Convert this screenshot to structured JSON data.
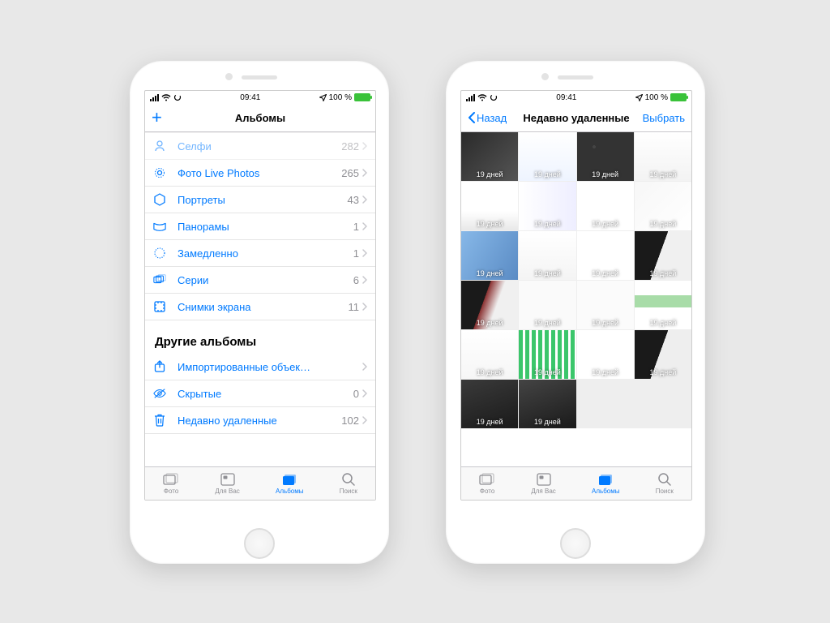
{
  "status": {
    "time": "09:41",
    "battery": "100 %"
  },
  "left": {
    "nav": {
      "title": "Альбомы"
    },
    "rows": [
      {
        "icon": "selfie",
        "label": "Селфи",
        "count": "282"
      },
      {
        "icon": "live",
        "label": "Фото Live Photos",
        "count": "265"
      },
      {
        "icon": "portrait",
        "label": "Портреты",
        "count": "43"
      },
      {
        "icon": "pano",
        "label": "Панорамы",
        "count": "1"
      },
      {
        "icon": "slomo",
        "label": "Замедленно",
        "count": "1"
      },
      {
        "icon": "burst",
        "label": "Серии",
        "count": "6"
      },
      {
        "icon": "screenshot",
        "label": "Снимки экрана",
        "count": "11"
      }
    ],
    "section2_title": "Другие альбомы",
    "rows2": [
      {
        "icon": "import",
        "label": "Импортированные объек…",
        "count": ""
      },
      {
        "icon": "hidden",
        "label": "Скрытые",
        "count": "0"
      },
      {
        "icon": "trash",
        "label": "Недавно удаленные",
        "count": "102"
      }
    ]
  },
  "right": {
    "nav": {
      "back": "Назад",
      "title": "Недавно удаленные",
      "action": "Выбрать"
    },
    "days_label": "19 дней",
    "thumbs": 22
  },
  "tabs": [
    {
      "name": "Фото"
    },
    {
      "name": "Для Вас"
    },
    {
      "name": "Альбомы"
    },
    {
      "name": "Поиск"
    }
  ]
}
